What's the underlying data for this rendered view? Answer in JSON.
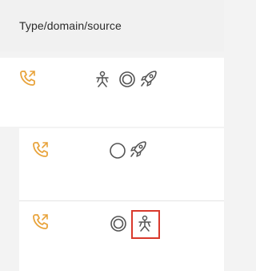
{
  "header": {
    "title": "Type/domain/source"
  },
  "rows": [
    {
      "type_icon": "phone-call-icon",
      "icons": [
        "figure-icon",
        "circle-ring-icon",
        "rocket-icon"
      ]
    },
    {
      "type_icon": "phone-call-icon",
      "icons": [
        "circle-icon",
        "rocket-icon"
      ]
    },
    {
      "type_icon": "phone-call-icon",
      "icons": [
        "circle-ring-icon",
        "figure-icon"
      ],
      "highlighted_icon": "figure-icon"
    }
  ],
  "colors": {
    "phone": "#e8a33b",
    "icon": "#555555",
    "highlight": "#d9392c",
    "background": "#f3f3f3",
    "row": "#ffffff"
  }
}
